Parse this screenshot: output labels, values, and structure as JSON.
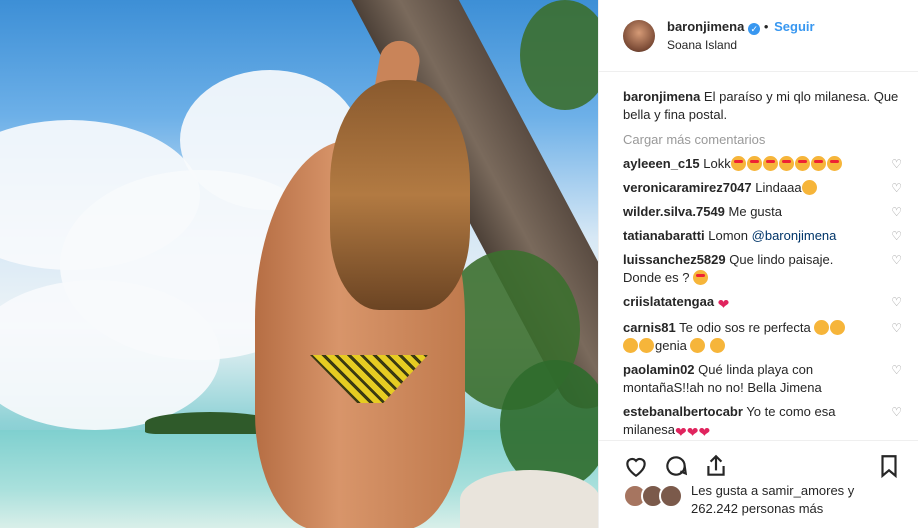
{
  "post": {
    "username": "baronjimena",
    "verified_glyph": "✓",
    "follow_separator": "•",
    "follow_label": "Seguir",
    "location": "Soana Island",
    "caption_user": "baronjimena",
    "caption_text": "El paraíso y mi qlo milanesa. Que bella y fina postal.",
    "load_more": "Cargar más comentarios"
  },
  "comments": [
    {
      "user": "ayleeen_c15",
      "text": "Lokk"
    },
    {
      "user": "veronicaramirez7047",
      "text": "Lindaaa"
    },
    {
      "user": "wilder.silva.7549",
      "text": "Me gusta"
    },
    {
      "user": "tatianabaratti",
      "text": "Lomon",
      "mention": "@baronjimena"
    },
    {
      "user": "luissanchez5829",
      "text": "Que lindo paisaje. Donde es ?"
    },
    {
      "user": "criislatatengaa",
      "text": ""
    },
    {
      "user": "carnis81",
      "text": "Te odio sos re perfecta",
      "text2": "genia"
    },
    {
      "user": "paolamin02",
      "text": "Qué linda playa con montañaS!!ah no no! Bella Jimena"
    },
    {
      "user": "estebanalbertocabr",
      "text": "Yo te como esa milanesa"
    }
  ],
  "likes": {
    "text": "Les gusta a samir_amores y 262.242 personas más"
  },
  "icons": {
    "comment_heart": "heart-outline-icon",
    "like": "heart-icon",
    "comment": "comment-icon",
    "share": "share-icon",
    "save": "bookmark-icon"
  },
  "colors": {
    "accent": "#3897f0",
    "text": "#262626",
    "muted": "#999999",
    "heart_emoji": "#e0245e"
  }
}
